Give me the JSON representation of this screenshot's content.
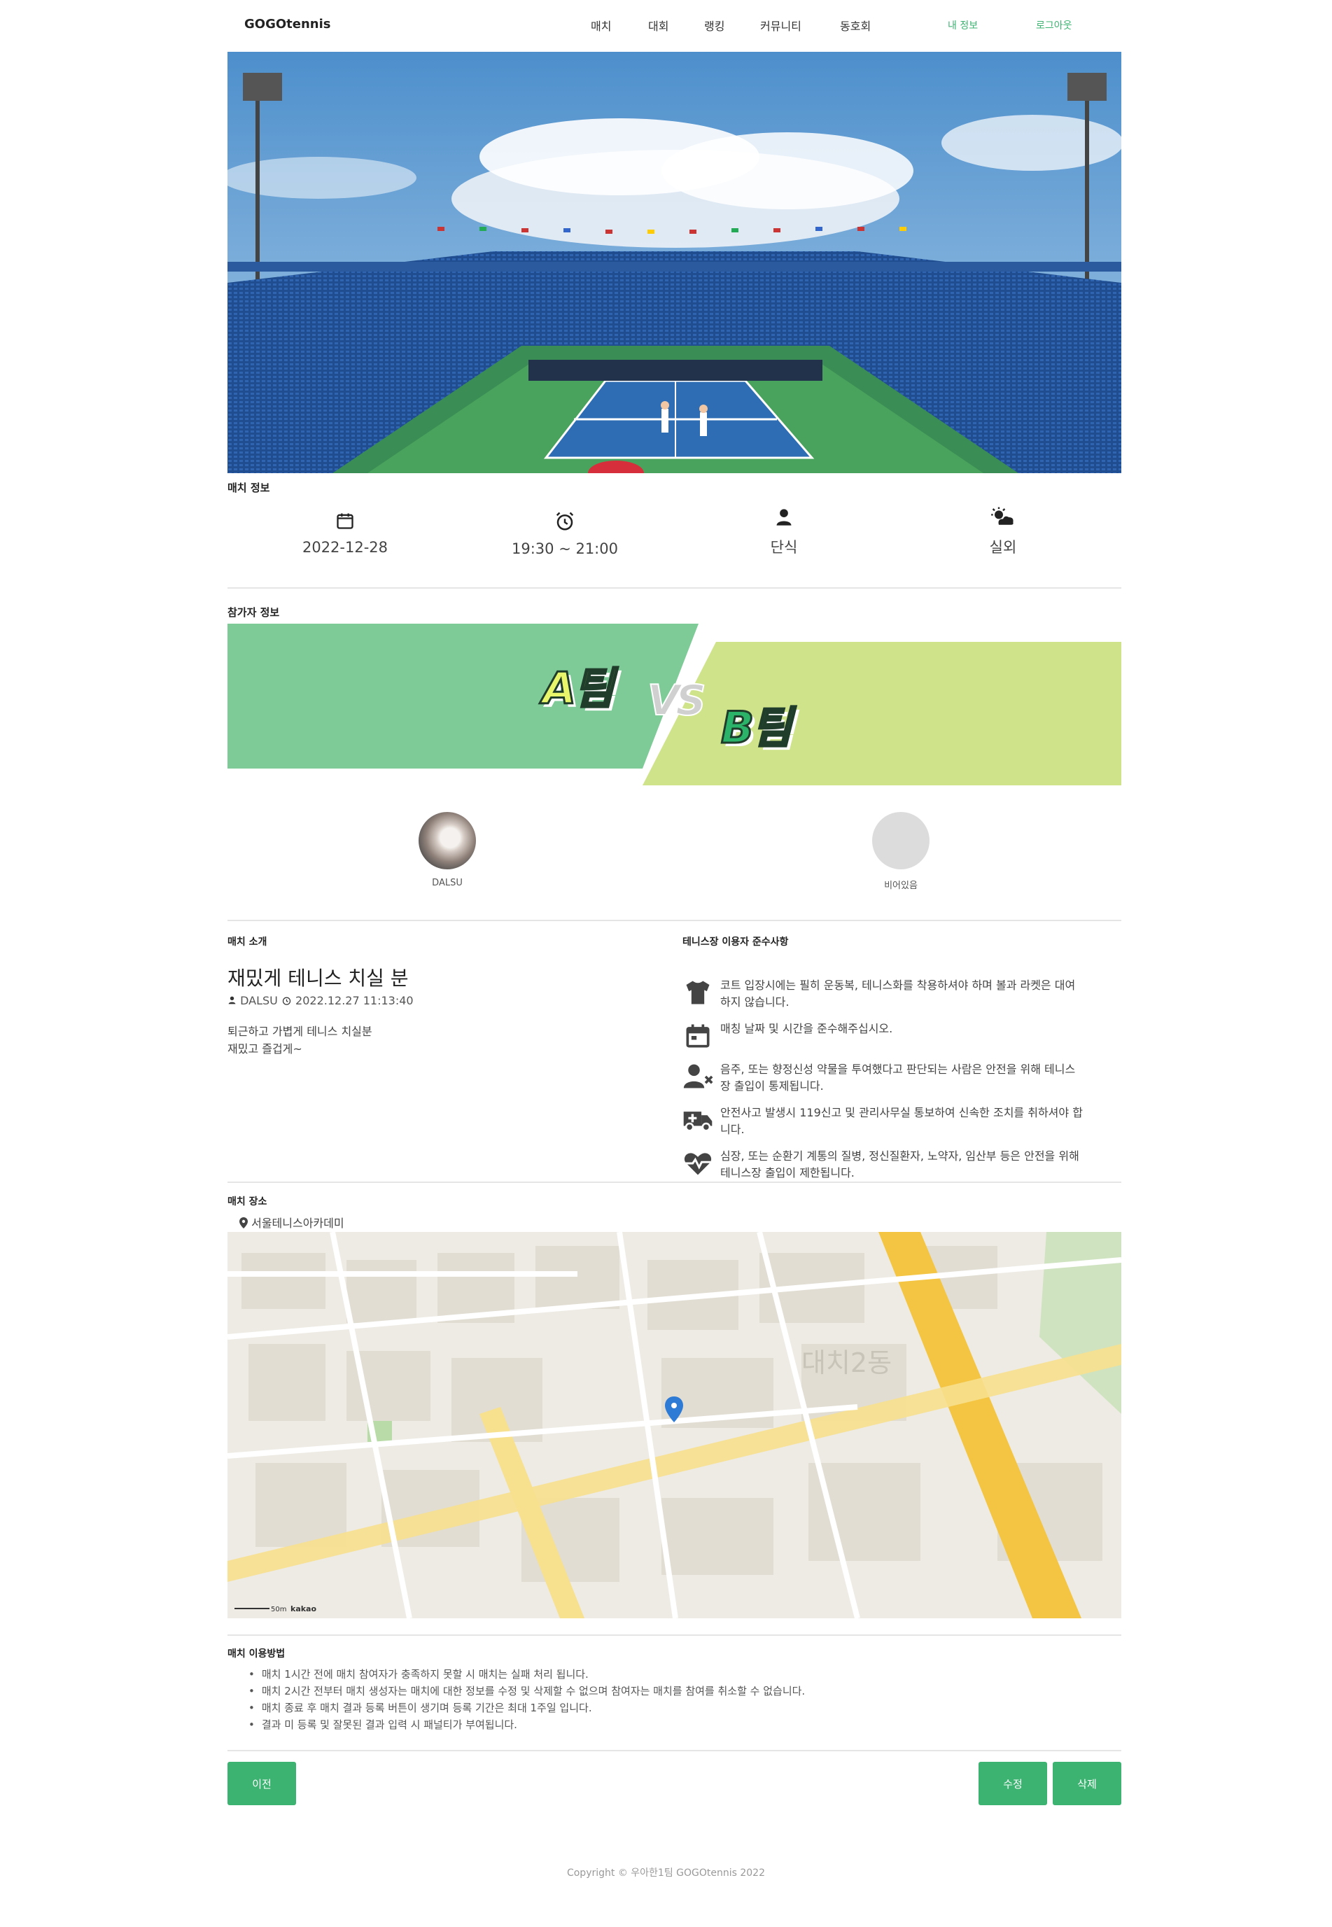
{
  "header": {
    "brand": "GOGOtennis",
    "nav": [
      "매치",
      "대회",
      "랭킹",
      "커뮤니티",
      "동호회"
    ],
    "my_info": "내 정보",
    "logout": "로그아웃"
  },
  "match_info": {
    "title": "매치 정보",
    "date_icon": "calendar-icon",
    "date": "2022-12-28",
    "time_icon": "alarm-clock-icon",
    "time": "19:30 ~ 21:00",
    "type_icon": "person-icon",
    "type": "단식",
    "venue_icon": "weather-icon",
    "venue": "실외"
  },
  "participants": {
    "title": "참가자 정보",
    "team_a": "A팀",
    "vs": "VS",
    "team_b": "B팀",
    "player_a": "DALSU",
    "player_b": "비어있음",
    "team_a_color": "#7ecb98",
    "team_b_color": "#cfe38b"
  },
  "intro": {
    "title": "매치 소개",
    "headline": "재밌게 테니스 치실 분",
    "author": "DALSU",
    "created_at": "2022.12.27 11:13:40",
    "body_lines": [
      "퇴근하고 가볍게 테니스 치실분",
      "재밌고 즐겁게~"
    ]
  },
  "rules": {
    "title": "테니스장 이용자 준수사항",
    "items": [
      {
        "icon": "shirt-icon",
        "text": "코트 입장시에는 필히 운동복, 테니스화를 착용하셔야 하며 볼과 라켓은 대여하지 않습니다."
      },
      {
        "icon": "calendar-icon",
        "text": "매칭 날짜 및 시간을 준수해주십시오."
      },
      {
        "icon": "user-x-icon",
        "text": "음주, 또는 향정신성 약물을 투여했다고 판단되는 사람은 안전을 위해 테니스장 출입이 통제됩니다."
      },
      {
        "icon": "ambulance-icon",
        "text": "안전사고 발생시 119신고 및 관리사무실 통보하여 신속한 조치를 취하셔야 합니다."
      },
      {
        "icon": "heart-pulse-icon",
        "text": "심장, 또는 순환기 계통의 질병, 정신질환자, 노약자, 임산부 등은 안전을 위해 테니스장 출입이 제한됩니다."
      }
    ]
  },
  "location": {
    "title": "매치 장소",
    "place": "서울테니스아카데미",
    "map_labels": {
      "district": "대치2동",
      "scale": "50m",
      "logo": "kakao"
    }
  },
  "usage": {
    "title": "매치 이용방법",
    "items": [
      "매치 1시간 전에 매치 참여자가 충족하지 못할 시 매치는 실패 처리 됩니다.",
      "매치 2시간 전부터 매치 생성자는 매치에 대한 정보를 수정 및 삭제할 수 없으며 참여자는 매치를 참여를 취소할 수 없습니다.",
      "매치 종료 후 매치 결과 등록 버튼이 생기며 등록 기간은 최대 1주일 입니다.",
      "결과 미 등록 및 잘못된 결과 입력 시 패널티가 부여됩니다."
    ]
  },
  "buttons": {
    "prev": "이전",
    "edit": "수정",
    "delete": "삭제"
  },
  "footer": "Copyright © 우아한1팀 GOGOtennis 2022"
}
